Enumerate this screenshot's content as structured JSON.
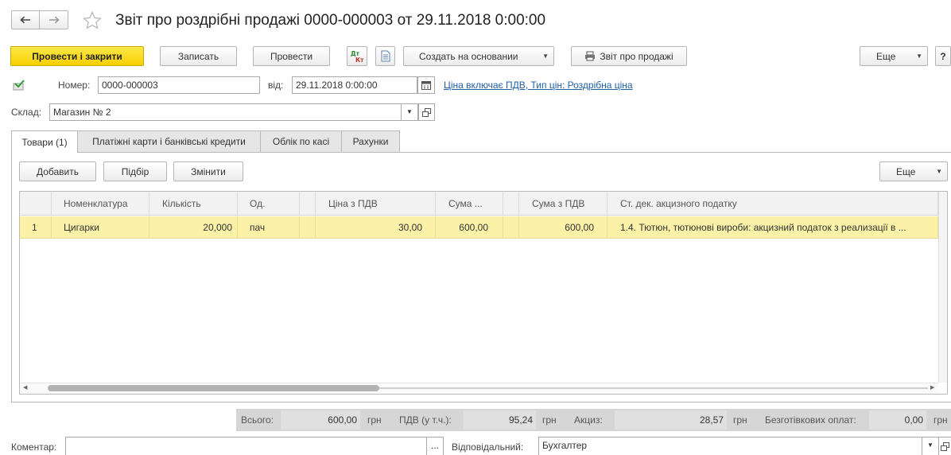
{
  "header": {
    "title": "Звіт про роздрібні продажі 0000-000003 от 29.11.2018 0:00:00"
  },
  "toolbar": {
    "post_close": "Провести і закрити",
    "save": "Записать",
    "post": "Провести",
    "create_based": "Создать на основании",
    "sales_report": "Звіт про продажі",
    "more": "Еще",
    "help": "?"
  },
  "form": {
    "number_label": "Номер:",
    "number_value": "0000-000003",
    "date_label": "від:",
    "date_value": "29.11.2018  0:00:00",
    "price_link": "Ціна включає ПДВ, Тип цін: Роздрібна ціна",
    "warehouse_label": "Склад:",
    "warehouse_value": "Магазин № 2"
  },
  "tabs": [
    {
      "label": "Товари (1)"
    },
    {
      "label": "Платіжні карти і банківські кредити"
    },
    {
      "label": "Облік по касі"
    },
    {
      "label": "Рахунки"
    }
  ],
  "table_toolbar": {
    "add": "Добавить",
    "select": "Підбір",
    "change": "Змінити",
    "more": "Еще"
  },
  "table": {
    "columns": [
      "Номенклатура",
      "Кількість",
      "Од.",
      "Ціна з ПДВ",
      "Сума ...",
      "Сума з ПДВ",
      "Ст. дек. акцизного податку"
    ],
    "rows": [
      {
        "n": "1",
        "item": "Цигарки",
        "qty": "20,000",
        "unit": "пач",
        "price": "30,00",
        "sum": "600,00",
        "sum_vat": "600,00",
        "excise": "1.4. Тютюн, тютюнові вироби: акцизний податок з реализації в ..."
      }
    ]
  },
  "totals": {
    "total_label": "Всього:",
    "total_value": "600,00",
    "vat_label": "ПДВ (у т.ч.):",
    "vat_value": "95,24",
    "excise_label": "Акциз:",
    "excise_value": "28,57",
    "cashless_label": "Безготівкових оплат:",
    "cashless_value": "0,00",
    "currency": "грн"
  },
  "footer": {
    "comment_label": "Коментар:",
    "comment_value": "",
    "comment_btn": "...",
    "responsible_label": "Відповідальний:",
    "responsible_value": "Бухгалтер"
  },
  "colors": {
    "accent_yellow": "#f5cf00",
    "selected_row": "#fbf2a8",
    "link_blue": "#1f5fa8"
  }
}
